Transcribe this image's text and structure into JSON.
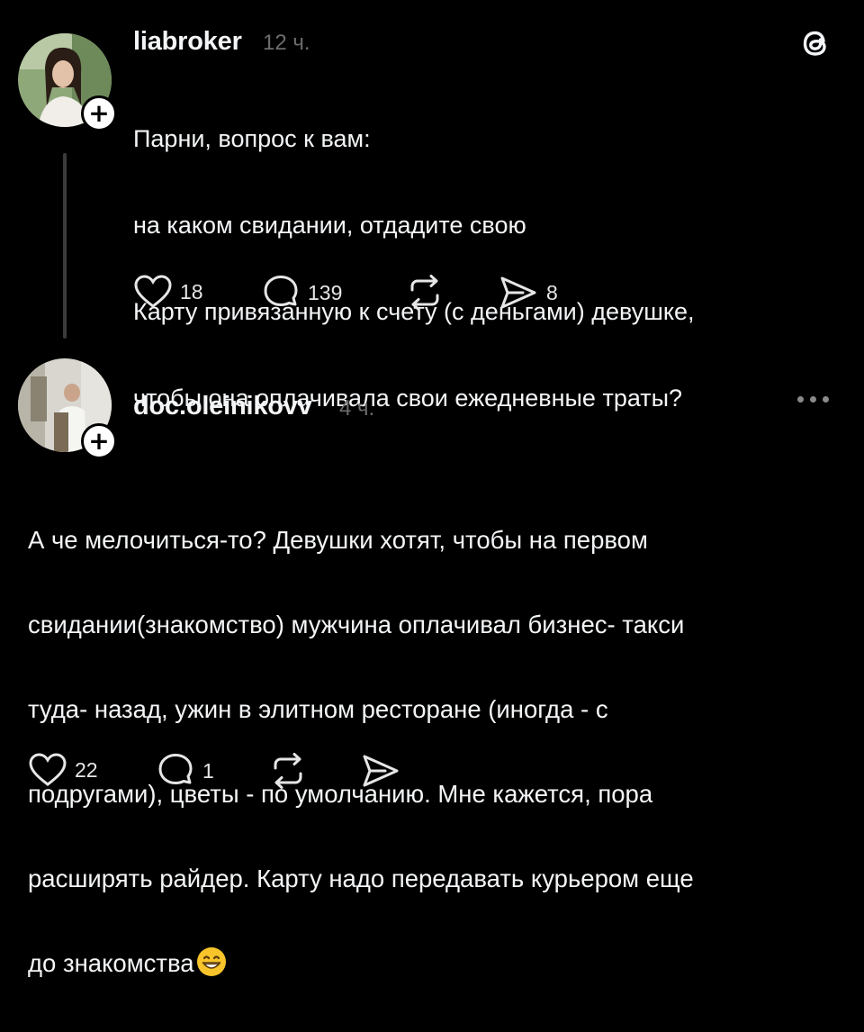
{
  "post1": {
    "username": "liabroker",
    "time": "12 ч.",
    "text_lines": [
      "Парни, вопрос к вам:",
      "на каком свидании, отдадите свою",
      "Карту привязанную к счету (с деньгами) девушке,",
      "чтобы она оплачивала свои ежедневные траты?"
    ],
    "likes": "18",
    "replies": "139",
    "shares": "8"
  },
  "post2": {
    "username": "doc.oleinikovv",
    "time": "4 ч.",
    "text_lines": [
      "А че мелочиться-то? Девушки хотят, чтобы на первом",
      "свидании(знакомство) мужчина оплачивал бизнес- такси",
      "туда- назад, ужин в элитном ресторане (иногда - с",
      "подругами), цветы - по умолчанию. Мне кажется, пора",
      "расширять райдер. Карту надо передавать курьером еще",
      "до знакомства"
    ],
    "likes": "22",
    "replies": "1"
  },
  "icons": {
    "like": "heart-icon",
    "reply": "comment-icon",
    "repost": "repost-icon",
    "share": "send-icon",
    "logo": "threads-logo-icon",
    "more": "more-icon",
    "emoji": "grinning-face-icon",
    "follow": "plus-icon"
  },
  "follow_symbol": "+",
  "colors": {
    "background": "#000000",
    "text": "#f3f5f7",
    "muted": "#6c6c6c",
    "thread_line": "#3b3b3b"
  }
}
